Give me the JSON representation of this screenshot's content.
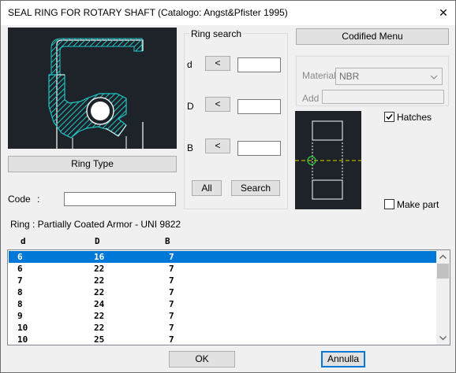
{
  "window": {
    "title": "SEAL RING FOR ROTARY SHAFT (Catalogo: Angst&Pfister 1995)",
    "close_glyph": "✕"
  },
  "ring_type_button": "Ring Type",
  "code": {
    "label": "Code",
    "colon": ":",
    "value": ""
  },
  "ring_search": {
    "title": "Ring search",
    "fields": [
      {
        "label": "d",
        "button": "<",
        "value": ""
      },
      {
        "label": "D",
        "button": "<",
        "value": ""
      },
      {
        "label": "B",
        "button": "<",
        "value": ""
      }
    ],
    "all_button": "All",
    "search_button": "Search"
  },
  "codified_menu_button": "Codified Menu",
  "material": {
    "label": "Material",
    "value": "NBR",
    "add_label": "Add",
    "add_value": ""
  },
  "hatches": {
    "label": "Hatches",
    "checked": true
  },
  "make_part": {
    "label": "Make part",
    "checked": false
  },
  "ring_info": "Ring : Partially Coated Armor - UNI 9822",
  "table": {
    "columns": [
      "d",
      "D",
      "B"
    ],
    "rows": [
      [
        "6",
        "16",
        "7"
      ],
      [
        "6",
        "22",
        "7"
      ],
      [
        "7",
        "22",
        "7"
      ],
      [
        "8",
        "22",
        "7"
      ],
      [
        "8",
        "24",
        "7"
      ],
      [
        "9",
        "22",
        "7"
      ],
      [
        "10",
        "22",
        "7"
      ],
      [
        "10",
        "25",
        "7"
      ]
    ],
    "selected_index": 0
  },
  "ok_button": "OK",
  "cancel_button": "Annulla",
  "colors": {
    "selection": "#0078d7",
    "hatch": "#1fc6c6",
    "preview_bg": "#1e2329",
    "centerline": "#e0d000",
    "center_marker": "#2ecc40"
  },
  "icons": {
    "close": "close-icon",
    "check": "check-icon",
    "scroll_up": "arrow-up-icon",
    "scroll_down": "arrow-down-icon",
    "dropdown": "chevron-down-icon"
  }
}
